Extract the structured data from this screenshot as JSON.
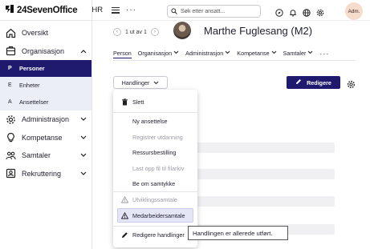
{
  "brand": {
    "name": "24SevenOffice",
    "module": "HR"
  },
  "sidebar": {
    "items": [
      {
        "label": "Oversikt",
        "icon": "home-icon"
      },
      {
        "label": "Organisasjon",
        "icon": "org-icon"
      },
      {
        "label": "Administrasjon",
        "icon": "gear-icon"
      },
      {
        "label": "Kompetanse",
        "icon": "bulb-icon"
      },
      {
        "label": "Samtaler",
        "icon": "people-icon"
      },
      {
        "label": "Rekruttering",
        "icon": "id-card-icon"
      }
    ],
    "subitems": [
      {
        "letter": "P",
        "label": "Personer",
        "active": true
      },
      {
        "letter": "E",
        "label": "Enheter",
        "active": false
      },
      {
        "letter": "A",
        "label": "Ansettelser",
        "active": false
      }
    ]
  },
  "topbar": {
    "search_placeholder": "Søk etter ansatt...",
    "user_initials": "Adm."
  },
  "person": {
    "pager": "1 ut av 1",
    "name": "Marthe Fuglesang (M2)"
  },
  "tabs": [
    {
      "label": "Person",
      "active": true
    },
    {
      "label": "Organisasjon",
      "active": false
    },
    {
      "label": "Administrasjon",
      "active": false
    },
    {
      "label": "Kompetanse",
      "active": false
    },
    {
      "label": "Samtaler",
      "active": false
    }
  ],
  "actions": {
    "handlinger": "Handlinger",
    "redigere": "Redigere"
  },
  "menu": {
    "items": [
      {
        "label": "Slett",
        "icon": "trash-icon",
        "disabled": false
      },
      {
        "label": "Ny ansettelse",
        "icon": "",
        "disabled": false
      },
      {
        "label": "Registrer utdanning",
        "icon": "",
        "disabled": true
      },
      {
        "label": "Ressursbestilling",
        "icon": "",
        "disabled": false
      },
      {
        "label": "Last opp fil til filarkiv",
        "icon": "",
        "disabled": true
      },
      {
        "label": "Be om samtykke",
        "icon": "",
        "disabled": false
      },
      {
        "label": "Utviklingssamtale",
        "icon": "warning-icon",
        "disabled": true
      },
      {
        "label": "Medarbeidersamtale",
        "icon": "warning-icon",
        "disabled": false,
        "highlighted": true
      },
      {
        "label": "Redigere handlinger",
        "icon": "pencil-icon",
        "disabled": false
      }
    ]
  },
  "tooltip": "Handlingen er allerede utført.",
  "colors": {
    "primary": "#1f1a6e",
    "sidebar_active_bg": "#ebedf7",
    "highlight": "#e4e6f5"
  }
}
